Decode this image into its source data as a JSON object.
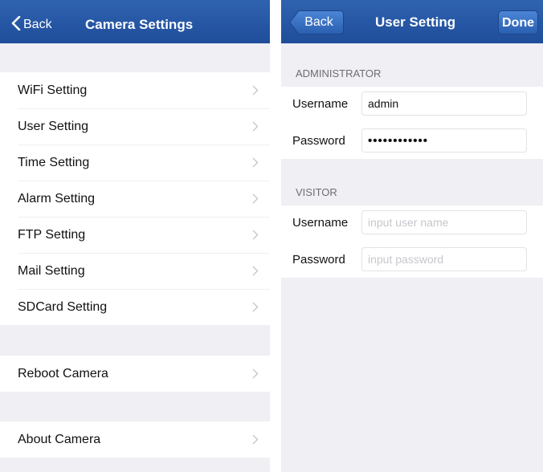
{
  "camera_settings": {
    "back_label": "Back",
    "title": "Camera Settings",
    "items_group1": [
      {
        "label": "WiFi Setting",
        "icon": "chevron-right-icon"
      },
      {
        "label": "User Setting",
        "icon": "chevron-right-icon"
      },
      {
        "label": "Time Setting",
        "icon": "chevron-right-icon"
      },
      {
        "label": "Alarm Setting",
        "icon": "chevron-right-icon"
      },
      {
        "label": "FTP Setting",
        "icon": "chevron-right-icon"
      },
      {
        "label": "Mail Setting",
        "icon": "chevron-right-icon"
      },
      {
        "label": "SDCard Setting",
        "icon": "chevron-right-icon"
      }
    ],
    "reboot_label": "Reboot Camera",
    "about_label": "About Camera"
  },
  "user_setting": {
    "back_label": "Back",
    "title": "User Setting",
    "done_label": "Done",
    "administrator": {
      "header": "ADMINISTRATOR",
      "username_label": "Username",
      "username_value": "admin",
      "password_label": "Password",
      "password_value": "••••••••••••"
    },
    "visitor": {
      "header": "VISITOR",
      "username_label": "Username",
      "username_placeholder": "input user name",
      "password_label": "Password",
      "password_placeholder": "input password"
    }
  },
  "colors": {
    "navbar": "#2557a5",
    "background": "#efeff4",
    "disclosure": "#c7c7cc",
    "placeholder": "#c7c7cd"
  }
}
